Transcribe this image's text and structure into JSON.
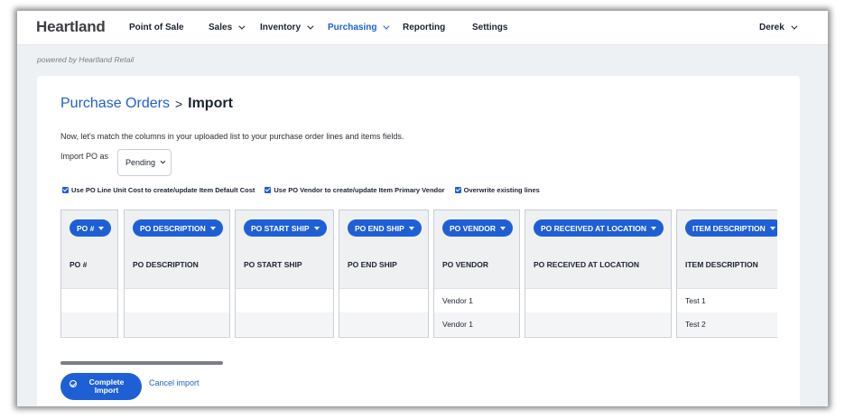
{
  "brand": {
    "logo": "Heartland",
    "powered_by": "powered by Heartland Retail"
  },
  "nav": {
    "items": [
      {
        "label": "Point of Sale",
        "dropdown": false,
        "active": false
      },
      {
        "label": "Sales",
        "dropdown": true,
        "active": false
      },
      {
        "label": "Inventory",
        "dropdown": true,
        "active": false
      },
      {
        "label": "Purchasing",
        "dropdown": true,
        "active": true
      },
      {
        "label": "Reporting",
        "dropdown": false,
        "active": false
      },
      {
        "label": "Settings",
        "dropdown": false,
        "active": false
      }
    ],
    "user": "Derek"
  },
  "page": {
    "breadcrumb_parent": "Purchase Orders",
    "breadcrumb_separator": ">",
    "breadcrumb_current": "Import",
    "intro": "Now, let's match the columns in your uploaded list to your purchase order lines and items fields.",
    "import_as_label": "Import PO as",
    "import_as_value": "Pending"
  },
  "options": [
    {
      "label": "Use PO Line Unit Cost to create/update Item Default Cost",
      "checked": true
    },
    {
      "label": "Use PO Vendor to create/update Item Primary Vendor",
      "checked": true
    },
    {
      "label": "Overwrite existing lines",
      "checked": true
    }
  ],
  "columns": [
    {
      "mapping": "PO #",
      "header": "PO #",
      "rows": [
        "",
        ""
      ]
    },
    {
      "mapping": "PO DESCRIPTION",
      "header": "PO DESCRIPTION",
      "rows": [
        "",
        ""
      ]
    },
    {
      "mapping": "PO START SHIP",
      "header": "PO START SHIP",
      "rows": [
        "",
        ""
      ]
    },
    {
      "mapping": "PO END SHIP",
      "header": "PO END SHIP",
      "rows": [
        "",
        ""
      ]
    },
    {
      "mapping": "PO VENDOR",
      "header": "PO VENDOR",
      "rows": [
        "Vendor 1",
        "Vendor 1"
      ]
    },
    {
      "mapping": "PO RECEIVED AT LOCATION",
      "header": "PO RECEIVED AT LOCATION",
      "rows": [
        "",
        ""
      ]
    },
    {
      "mapping": "ITEM DESCRIPTION",
      "header": "ITEM DESCRIPTION",
      "rows": [
        "Test 1",
        "Test 2"
      ]
    }
  ],
  "actions": {
    "complete": "Complete Import",
    "cancel": "Cancel import"
  },
  "colors": {
    "accent": "#1f5fd6",
    "text": "#1d2430",
    "background": "#eef1f4"
  }
}
